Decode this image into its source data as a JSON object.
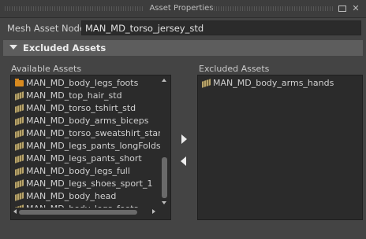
{
  "window": {
    "title": "Asset Properties"
  },
  "mesh_asset_node": {
    "label": "Mesh Asset Node",
    "value": "MAN_MD_torso_jersey_std"
  },
  "excluded_section": {
    "title": "Excluded Assets",
    "expanded": true
  },
  "available_assets": {
    "label": "Available Assets",
    "items": [
      {
        "name": "MAN_MD_body_legs_foots",
        "icon": "folder-icon"
      },
      {
        "name": "MAN_MD_top_hair_std",
        "icon": "mesh-icon"
      },
      {
        "name": "MAN_MD_torso_tshirt_std",
        "icon": "mesh-icon"
      },
      {
        "name": "MAN_MD_body_arms_biceps",
        "icon": "mesh-icon"
      },
      {
        "name": "MAN_MD_torso_sweatshirt_stanc",
        "icon": "mesh-icon"
      },
      {
        "name": "MAN_MD_legs_pants_longFolds",
        "icon": "mesh-icon"
      },
      {
        "name": "MAN_MD_legs_pants_short",
        "icon": "mesh-icon"
      },
      {
        "name": "MAN_MD_body_legs_full",
        "icon": "mesh-icon"
      },
      {
        "name": "MAN_MD_legs_shoes_sport_1",
        "icon": "mesh-icon"
      },
      {
        "name": "MAN_MD_body_head",
        "icon": "mesh-icon"
      },
      {
        "name": "MAN_MD_body_legs_foots",
        "icon": "mesh-icon"
      }
    ]
  },
  "excluded_assets": {
    "label": "Excluded Assets",
    "items": [
      {
        "name": "MAN_MD_body_arms_hands",
        "icon": "mesh-icon"
      }
    ]
  },
  "colors": {
    "background": "#444444",
    "list_background": "#2b2b2b",
    "section_header": "#5d5d5d",
    "folder_icon": "#d88a1f"
  }
}
